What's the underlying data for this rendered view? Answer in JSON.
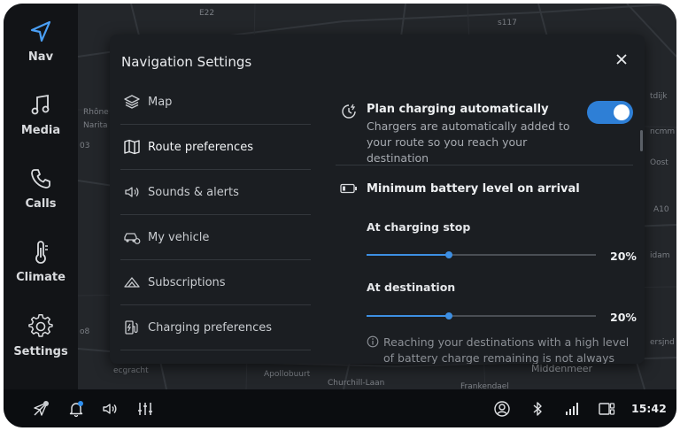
{
  "rail": {
    "items": [
      {
        "label": "Nav",
        "icon": "navigation-arrow-icon",
        "active": true
      },
      {
        "label": "Media",
        "icon": "music-note-icon"
      },
      {
        "label": "Calls",
        "icon": "phone-icon"
      },
      {
        "label": "Climate",
        "icon": "thermometer-icon"
      },
      {
        "label": "Settings",
        "icon": "gear-icon"
      }
    ]
  },
  "map": {
    "labels": [
      "E22",
      "s117",
      "Rhône",
      "Narita",
      "03",
      "A10",
      "tdijk",
      "ncmm",
      "Oost",
      "idam",
      "ersjnd",
      "ecgracht",
      "Apollobuurt",
      "Churchill-Laan",
      "Frankendael",
      "Middenmeer",
      "o8"
    ]
  },
  "dialog": {
    "title": "Navigation Settings",
    "menu": [
      {
        "label": "Map",
        "icon": "layers-icon"
      },
      {
        "label": "Route preferences",
        "icon": "map-icon"
      },
      {
        "label": "Sounds & alerts",
        "icon": "speaker-icon"
      },
      {
        "label": "My vehicle",
        "icon": "car-icon"
      },
      {
        "label": "Subscriptions",
        "icon": "subscription-icon"
      },
      {
        "label": "Charging preferences",
        "icon": "charging-station-icon"
      }
    ],
    "active_menu": "Route preferences",
    "plan_charging": {
      "title": "Plan charging automatically",
      "description": "Chargers are automatically added to your route so you reach your destination",
      "enabled": true
    },
    "battery": {
      "title": "Minimum battery level on arrival",
      "charging_stop": {
        "label": "At charging stop",
        "value_text": "20%",
        "fraction": 0.36
      },
      "destination": {
        "label": "At destination",
        "value_text": "20%",
        "fraction": 0.36
      },
      "note": "Reaching your destinations with a high level of battery charge remaining is not always possible"
    }
  },
  "bottom_bar": {
    "clock": "15:42"
  },
  "colors": {
    "accent": "#2e7fd6",
    "nav_active": "#4a9ff5"
  }
}
